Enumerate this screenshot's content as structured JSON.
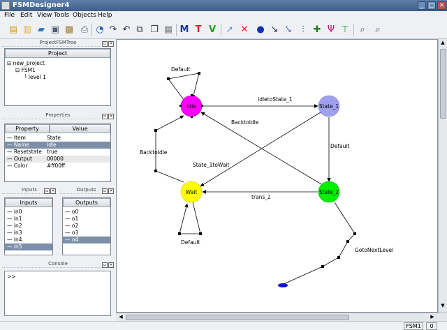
{
  "window": {
    "title": "FSMDesigner4"
  },
  "menu": [
    "File",
    "Edit",
    "View",
    "Tools",
    "Objects",
    "Help"
  ],
  "docks": {
    "project_tree": {
      "dock_title": "ProjectFSMTree",
      "header": "Project",
      "items": [
        "new_project",
        "FSM1",
        "level 1"
      ]
    },
    "properties": {
      "dock_title": "Properties",
      "col_property": "Property",
      "col_value": "Value",
      "rows": [
        {
          "name": "Item",
          "value": "State"
        },
        {
          "name": "Name",
          "value": "Idle"
        },
        {
          "name": "Resetstate",
          "value": "true"
        },
        {
          "name": "Output",
          "value": "00000"
        },
        {
          "name": "Color",
          "value": "#ff00ff"
        }
      ]
    },
    "inputs": {
      "dock_title": "Inputs",
      "header": "Inputs",
      "items": [
        "in0",
        "in1",
        "in2",
        "in3",
        "in4",
        "in5"
      ]
    },
    "outputs": {
      "dock_title": "Outputs",
      "header": "Outputs",
      "items": [
        "o0",
        "o1",
        "o2",
        "o3",
        "o4"
      ]
    },
    "console": {
      "dock_title": "Console",
      "prompt": ">>"
    }
  },
  "diagram": {
    "states": [
      {
        "name": "Idle",
        "color": "#ff00ff"
      },
      {
        "name": "State_1",
        "color": "#a0a0f0"
      },
      {
        "name": "Wait",
        "color": "#ffff00"
      },
      {
        "name": "State_2",
        "color": "#00ee00"
      }
    ],
    "transitions": {
      "idle_loop": "Default",
      "idle_to_state1": "IdletoState_1",
      "back_to_idle": "BacktoIdle",
      "state1_default": "Default",
      "state1_to_wait": "State_1toWait",
      "wait_back": "BacktoIdle",
      "trans2": "trans_2",
      "wait_loop": "Default",
      "goto_next": "GotoNextLevel"
    }
  },
  "status": {
    "fsm": "FSM1",
    "level": "0"
  }
}
